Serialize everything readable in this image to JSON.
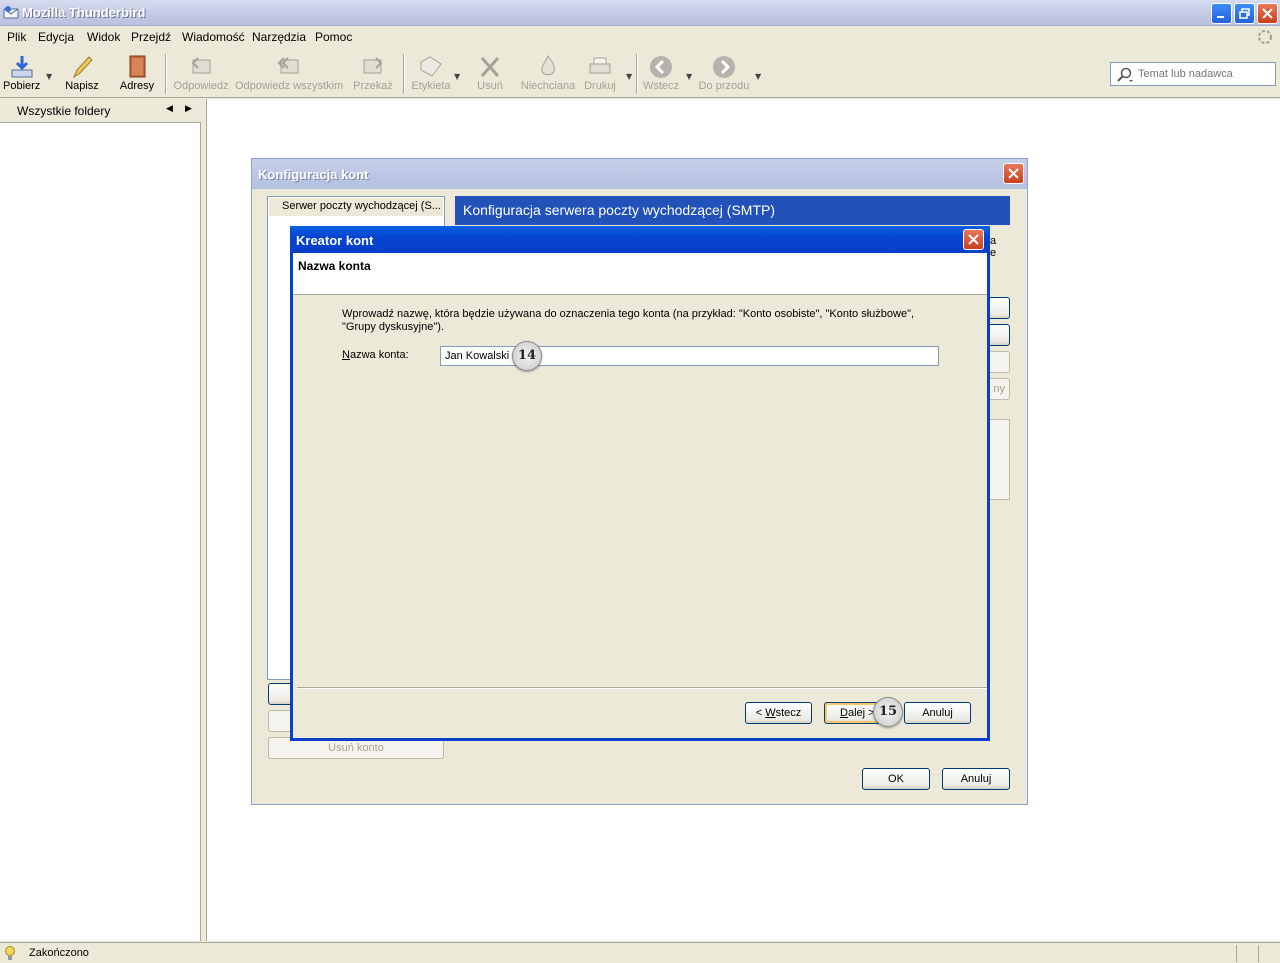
{
  "window": {
    "title": "Mozilla Thunderbird"
  },
  "menu": [
    "Plik",
    "Edycja",
    "Widok",
    "Przejdź",
    "Wiadomość",
    "Narzędzia",
    "Pomoc"
  ],
  "toolbar": {
    "get": "Pobierz",
    "write": "Napisz",
    "addresses": "Adresy",
    "reply": "Odpowiedz",
    "reply_all": "Odpowiedz wszystkim",
    "forward": "Przekaż",
    "tag": "Etykieta",
    "delete": "Usuń",
    "junk": "Niechciana",
    "print": "Drukuj",
    "back": "Wstecz",
    "forward_nav": "Do przodu"
  },
  "search": {
    "placeholder": "Temat lub nadawca"
  },
  "folder_pane": {
    "header": "Wszystkie foldery"
  },
  "status": {
    "text": "Zakończono"
  },
  "account_dialog": {
    "title": "Konfiguracja kont",
    "tree_item": "Serwer poczty wychodzącej (S...",
    "banner": "Konfiguracja serwera poczty wychodzącej (SMTP)",
    "remove_account": "Usuń konto",
    "ok": "OK",
    "cancel": "Anuluj",
    "frag_a": "a",
    "frag_e": "e",
    "frag_ny": "ny"
  },
  "wizard": {
    "title": "Kreator kont",
    "heading": "Nazwa konta",
    "description": "Wprowadź nazwę, która będzie używana do oznaczenia tego konta (na przykład: \"Konto osobiste\", \"Konto służbowe\", \"Grupy dyskusyjne\").",
    "field_label": "Nazwa konta:",
    "field_value": "Jan Kowalski",
    "back": "< Wstecz",
    "next": "Dalej >",
    "cancel": "Anuluj"
  },
  "markers": {
    "m14": "14",
    "m15": "15"
  }
}
